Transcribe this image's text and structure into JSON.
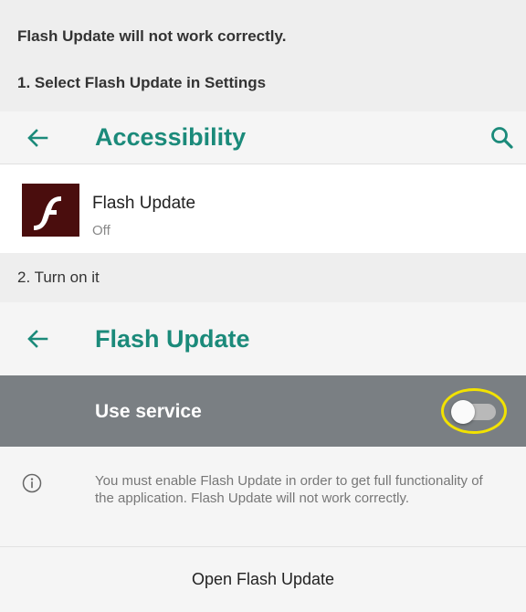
{
  "instructions": {
    "warning": "Flash Update will not work correctly.",
    "step1": "1. Select Flash Update in Settings",
    "step2": "2. Turn on it"
  },
  "accessibility_bar": {
    "title": "Accessibility",
    "back_icon": "arrow-left-icon",
    "search_icon": "search-icon"
  },
  "service_list": {
    "item": {
      "title": "Flash Update",
      "status": "Off",
      "icon": "flash-logo-icon"
    }
  },
  "service_bar": {
    "title": "Flash Update",
    "back_icon": "arrow-left-icon"
  },
  "use_service": {
    "label": "Use service",
    "toggle_on": false
  },
  "info": {
    "icon": "info-icon",
    "text": "You must enable Flash Update in order to get full functionality of the application. Flash Update will not work correctly."
  },
  "open_button": {
    "label": "Open Flash Update"
  },
  "colors": {
    "accent": "#1b8a7a",
    "highlight_ring": "#f2e200",
    "use_service_bg": "#7a7f83",
    "flash_icon_bg": "#4a0d0d"
  }
}
